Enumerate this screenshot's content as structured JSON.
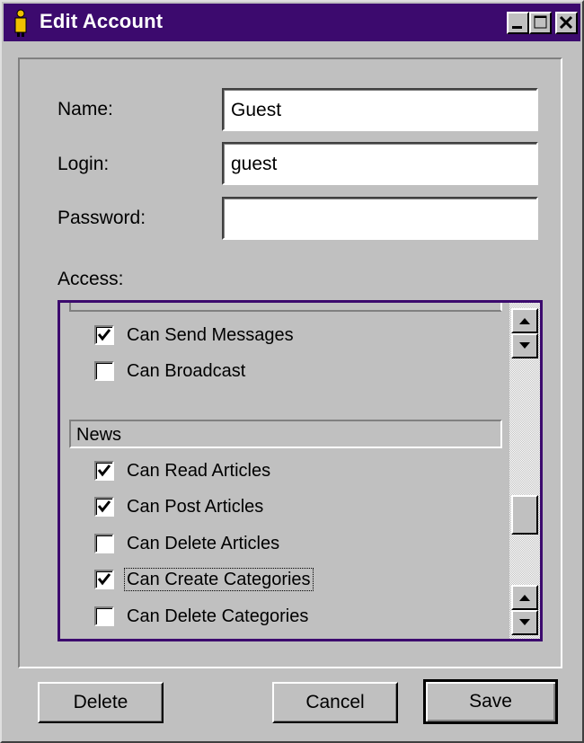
{
  "window": {
    "title": "Edit Account",
    "title_bar_color": "#3c0a6e"
  },
  "form": {
    "name_label": "Name:",
    "name_value": "Guest",
    "login_label": "Login:",
    "login_value": "guest",
    "password_label": "Password:",
    "password_value": "",
    "access_label": "Access:"
  },
  "access_list": {
    "items_top": [
      {
        "label": "Can Send Messages",
        "checked": true
      },
      {
        "label": "Can Broadcast",
        "checked": false
      }
    ],
    "section_news": "News",
    "items_news": [
      {
        "label": "Can Read Articles",
        "checked": true
      },
      {
        "label": "Can Post Articles",
        "checked": true
      },
      {
        "label": "Can Delete Articles",
        "checked": false
      },
      {
        "label": "Can Create Categories",
        "checked": true,
        "focused": true
      },
      {
        "label": "Can Delete Categories",
        "checked": false
      }
    ]
  },
  "buttons": {
    "delete": "Delete",
    "cancel": "Cancel",
    "save": "Save"
  }
}
